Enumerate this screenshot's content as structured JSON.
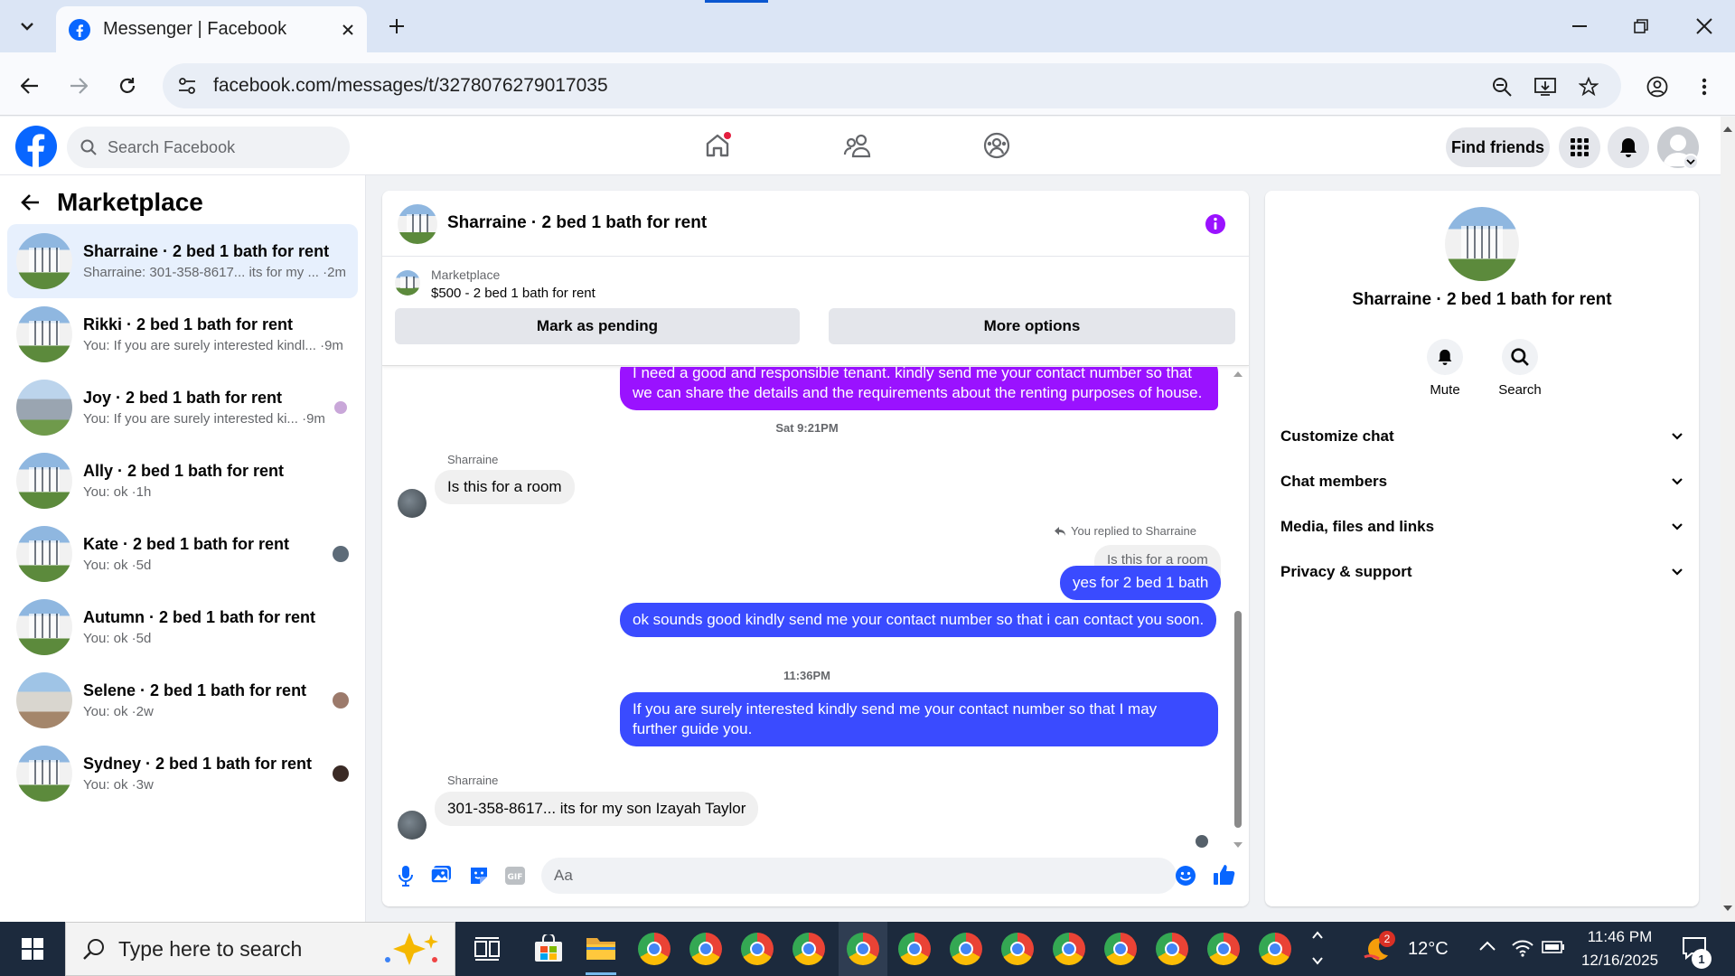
{
  "browser": {
    "tab_title": "Messenger | Facebook",
    "url": "facebook.com/messages/t/3278076279017035"
  },
  "fb": {
    "search_placeholder": "Search Facebook",
    "find_friends": "Find friends"
  },
  "sidebar": {
    "title": "Marketplace",
    "conversations": [
      {
        "title": "Sharraine · 2 bed 1 bath for rent",
        "snippet": "Sharraine: 301-358-8617... its for my ... ·2m"
      },
      {
        "title": "Rikki · 2 bed 1 bath for rent",
        "snippet": "You: If you are surely interested kindl... ·9m"
      },
      {
        "title": "Joy · 2 bed 1 bath for rent",
        "snippet": "You: If you are surely interested ki... ·9m"
      },
      {
        "title": "Ally · 2 bed 1 bath for rent",
        "snippet": "You: ok ·1h"
      },
      {
        "title": "Kate · 2 bed 1 bath for rent",
        "snippet": "You: ok ·5d"
      },
      {
        "title": "Autumn · 2 bed 1 bath for rent",
        "snippet": "You: ok ·5d"
      },
      {
        "title": "Selene · 2 bed 1 bath for rent",
        "snippet": "You: ok ·2w"
      },
      {
        "title": "Sydney · 2 bed 1 bath for rent",
        "snippet": "You: ok ·3w"
      }
    ]
  },
  "chat": {
    "title": "Sharraine · 2 bed 1 bath for rent",
    "listing_source": "Marketplace",
    "listing_title": "$500 - 2 bed 1 bath for rent",
    "mark_pending": "Mark as pending",
    "more_options": "More options",
    "messages": {
      "m1": "I need a good and responsible tenant. kindly send me your contact number so that we can share the details and the requirements about the renting purposes of house.",
      "ts1": "Sat 9:21PM",
      "sender1": "Sharraine",
      "m2": "Is this for a room",
      "reply_note": "You replied to Sharraine",
      "quoted": "Is this for a room",
      "m3": "yes for 2 bed 1 bath",
      "m4": "ok sounds good kindly  send me your contact number so that i can contact you soon.",
      "ts2": "11:36PM",
      "m5": "If you are surely interested kindly send me your contact number so that I may further guide you.",
      "sender2": "Sharraine",
      "m6": "301-358-8617... its for my son Izayah Taylor"
    },
    "input_placeholder": "Aa"
  },
  "info_panel": {
    "name": "Sharraine · 2 bed 1 bath for rent",
    "mute": "Mute",
    "search": "Search",
    "sections": [
      "Customize chat",
      "Chat members",
      "Media, files and links",
      "Privacy & support"
    ]
  },
  "taskbar": {
    "search_placeholder": "Type here to search",
    "weather": "12°C",
    "weather_badge": "2",
    "time": "11:46 PM",
    "date": "12/16/2025",
    "notif_count": "1"
  },
  "colors": {
    "fb_blue": "#0866ff",
    "outgoing_bubble": "#3a4bff",
    "highlight_bubble": "#9a12ff"
  }
}
